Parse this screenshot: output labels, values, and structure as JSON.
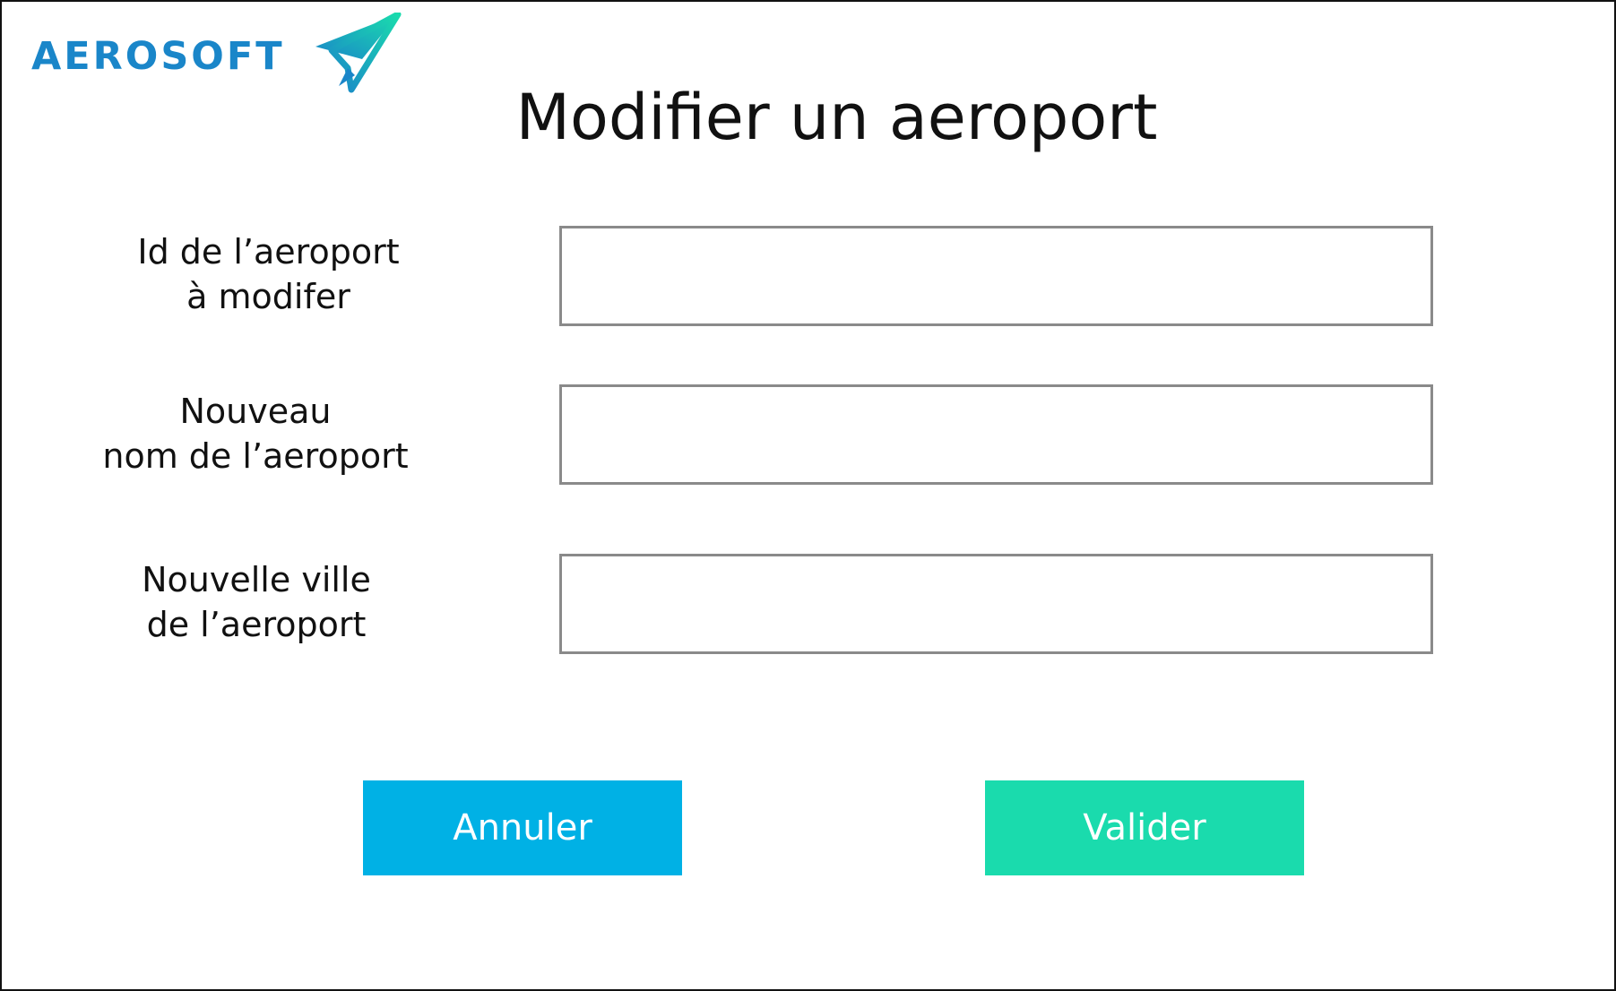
{
  "brand": {
    "name": "AEROSOFT",
    "text_color": "#1a86c9",
    "icon": "paper-plane-icon",
    "icon_colors": [
      "#1a86c9",
      "#1adbad"
    ]
  },
  "page": {
    "title": "Modifier un aeroport"
  },
  "form": {
    "fields": [
      {
        "label_line1": "Id de l’aeroport",
        "label_line2": "à modifer",
        "value": "",
        "placeholder": ""
      },
      {
        "label_line1": "Nouveau",
        "label_line2": "nom de l’aeroport",
        "value": "",
        "placeholder": ""
      },
      {
        "label_line1": "Nouvelle ville",
        "label_line2": "de l’aeroport",
        "value": "",
        "placeholder": ""
      }
    ]
  },
  "actions": {
    "cancel_label": "Annuler",
    "cancel_color": "#00b1e5",
    "validate_label": "Valider",
    "validate_color": "#1adbad"
  }
}
